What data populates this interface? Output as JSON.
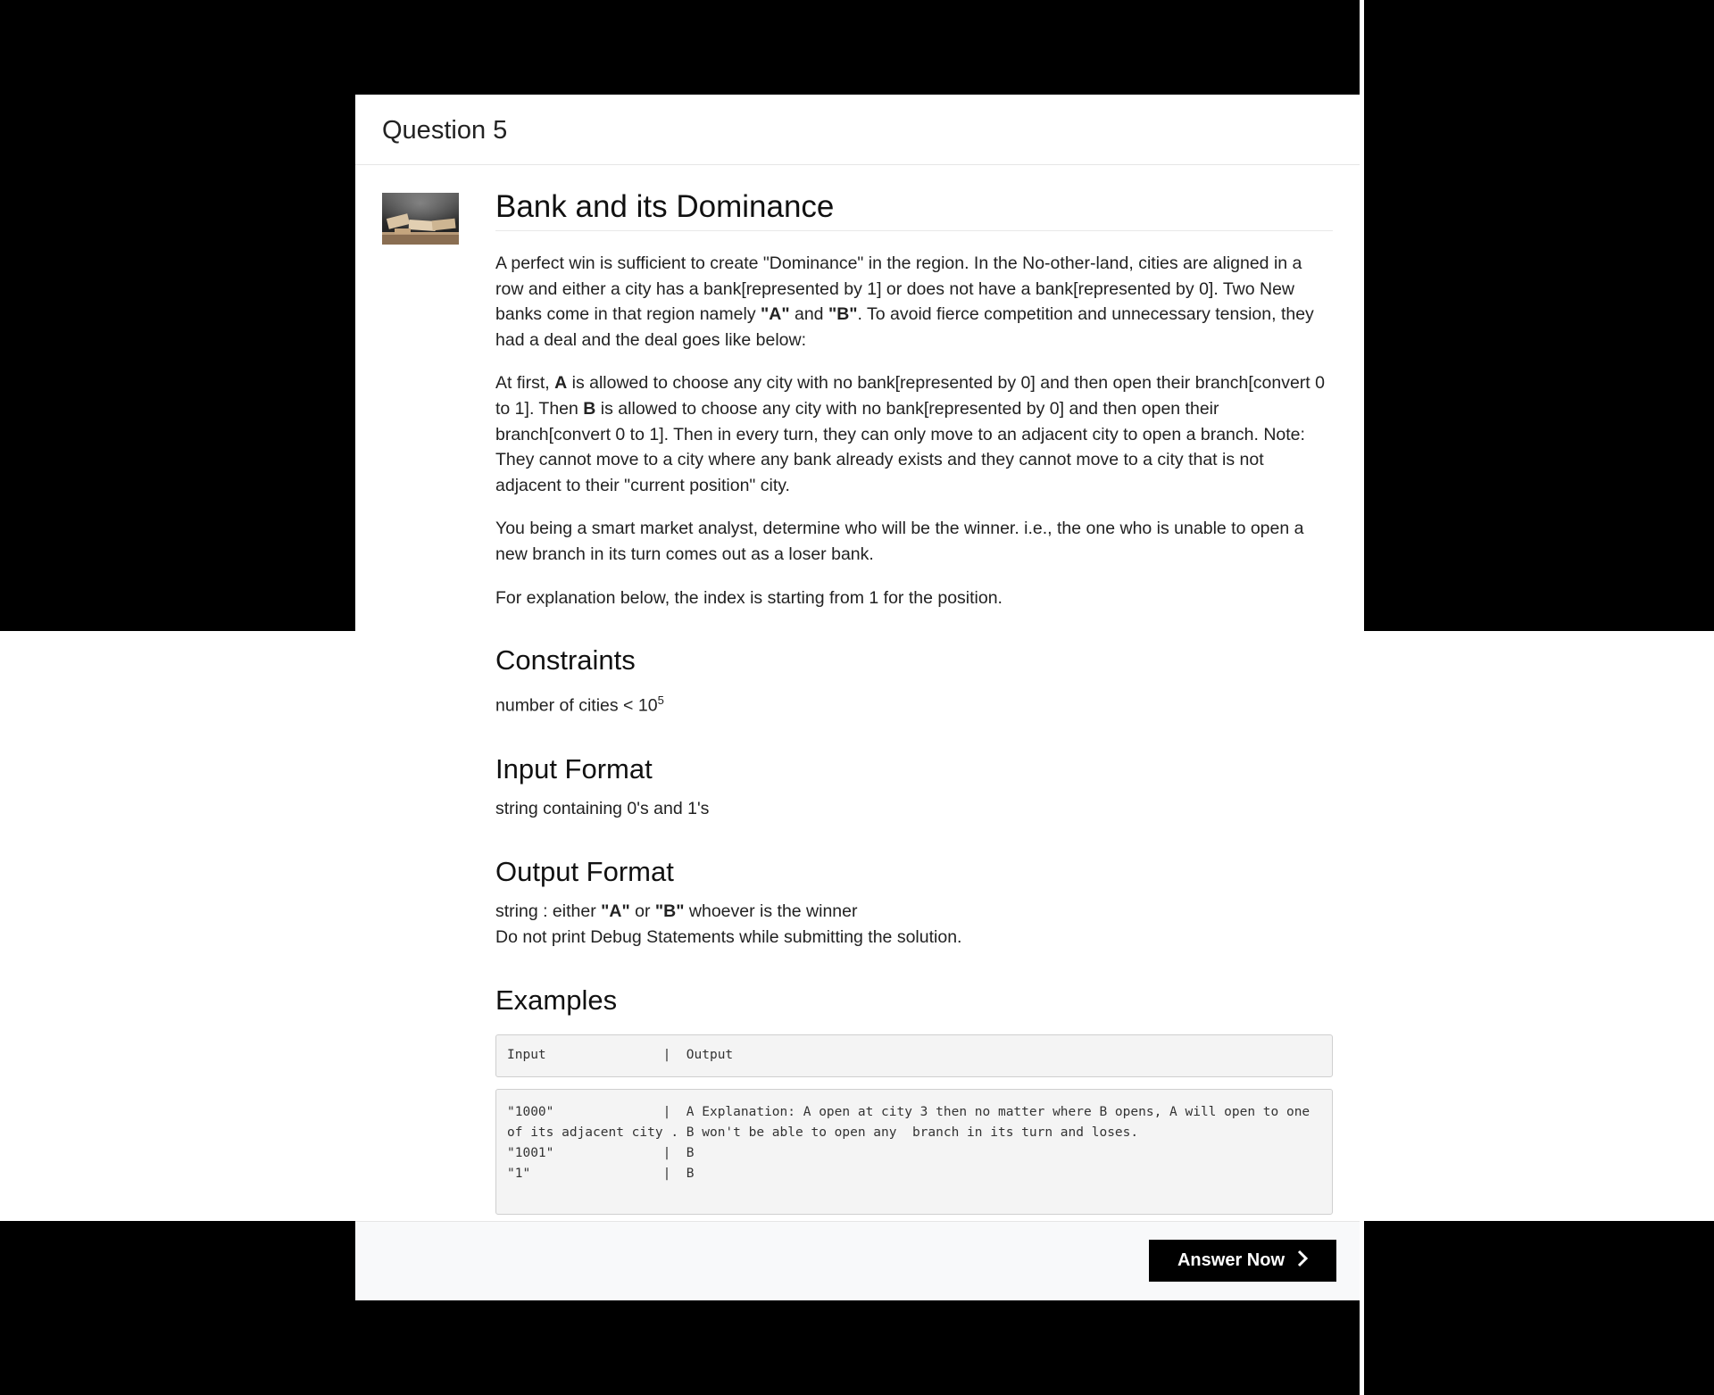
{
  "header": {
    "title": "Question 5"
  },
  "question": {
    "heading": "Bank and its Dominance",
    "p1": {
      "t1": "A perfect win is sufficient to create \"Dominance\" in the region. In the No-other-land, cities are aligned in a row and either a city has a bank[represented by 1] or does not have a bank[represented by 0]. Two New banks come in that region namely ",
      "b1": "\"A\"",
      "t2": " and ",
      "b2": "\"B\"",
      "t3": ". To avoid fierce competition and unnecessary tension, they had a deal and the deal goes like below:"
    },
    "p2": {
      "t1": "At first, ",
      "b1": "A",
      "t2": " is allowed to choose any city with no bank[represented by 0] and then open their branch[convert 0 to 1]. Then ",
      "b2": "B",
      "t3": " is allowed to choose any city with no bank[represented by 0] and then open their branch[convert 0 to 1]. Then in every turn, they can only move to an adjacent city to open a branch. Note: They cannot move to a city where any bank already exists and they cannot move to a city that is not adjacent to their \"current position\" city."
    },
    "p3": "You being a smart market analyst, determine who will be the winner. i.e., the one who is unable to open a new branch in its turn comes out as a loser bank.",
    "p4": "For explanation below, the index is starting from 1 for the position."
  },
  "constraints": {
    "heading": "Constraints",
    "text": "number of cities < 10",
    "exponent": "5"
  },
  "input_format": {
    "heading": "Input Format",
    "text": "string containing 0's and 1's"
  },
  "output_format": {
    "heading": "Output Format",
    "t1": "string : either ",
    "b1": "\"A\"",
    "t2": " or ",
    "b2": "\"B\"",
    "t3": " whoever is the winner",
    "line2": "Do not print Debug Statements while submitting the solution."
  },
  "examples": {
    "heading": "Examples",
    "header_row": "Input               |  Output",
    "rows": [
      "\"1000\"              |  A Explanation: A open at city 3 then no matter where B opens, A will open to one of its adjacent city . B won't be able to open any  branch in its turn and loses.",
      "\"1001\"              |  B",
      "\"1\"                 |  B"
    ]
  },
  "footer": {
    "answer_label": "Answer Now",
    "answer_icon": "chevron-right-icon"
  }
}
